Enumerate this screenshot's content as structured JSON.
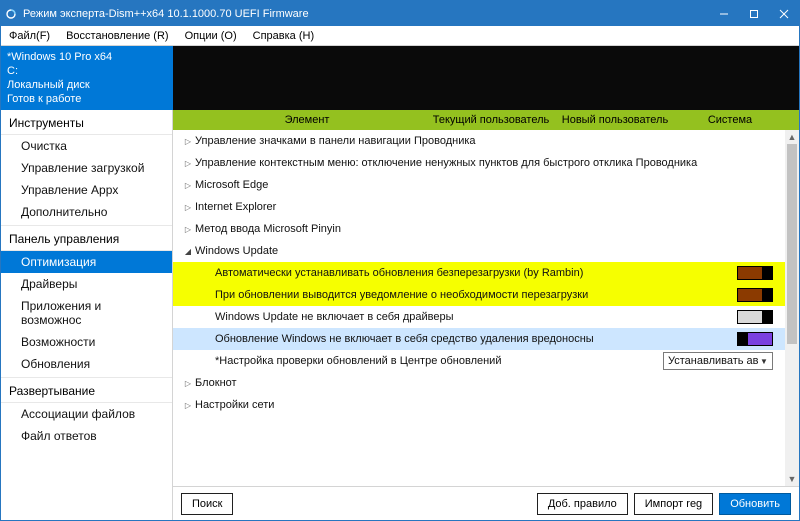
{
  "window": {
    "title": "Режим эксперта-Dism++x64 10.1.1000.70 UEFI Firmware"
  },
  "menu": {
    "file": "Файл(F)",
    "restore": "Восстановление (R)",
    "options": "Опции (O)",
    "help": "Справка (H)"
  },
  "info": {
    "line1": "*Windows 10 Pro x64",
    "line2": "C:",
    "line3": "Локальный диск",
    "line4": "Готов к работе"
  },
  "sidebar": {
    "section1": "Инструменты",
    "items1": [
      "Очистка",
      "Управление загрузкой",
      "Управление Appx",
      "Дополнительно"
    ],
    "section2": "Панель управления",
    "items2": [
      "Оптимизация",
      "Драйверы",
      "Приложения и возможнос",
      "Возможности",
      "Обновления"
    ],
    "section3": "Развертывание",
    "items3": [
      "Ассоциации файлов",
      "Файл ответов"
    ]
  },
  "columns": {
    "element": "Элемент",
    "cur_user": "Текущий пользователь",
    "new_user": "Новый пользователь",
    "system": "Система"
  },
  "rows": {
    "g0": "Управление значками в панели навигации Проводника",
    "g1": "Управление контекстным меню: отключение ненужных пунктов для быстрого отклика Проводника",
    "g2": "Microsoft Edge",
    "g3": "Internet Explorer",
    "g4": "Метод ввода Microsoft Pinyin",
    "g5": "Windows Update",
    "c5_0": "Автоматически устанавливать обновления безперезагрузки (by Rambin)",
    "c5_1": "При обновлении выводится уведомление о необходимости перезагрузки",
    "c5_2": "Windows Update не включает в себя драйверы",
    "c5_3": "Обновление Windows не включает в себя средство удаления вредоносны",
    "c5_4": "*Настройка проверки обновлений в Центре обновлений",
    "g6": "Блокнот",
    "g7": "Настройки сети"
  },
  "combo": {
    "value": "Устанавливать авт"
  },
  "footer": {
    "search": "Поиск",
    "add_rule": "Доб. правило",
    "import_reg": "Импорт reg",
    "refresh": "Обновить"
  }
}
